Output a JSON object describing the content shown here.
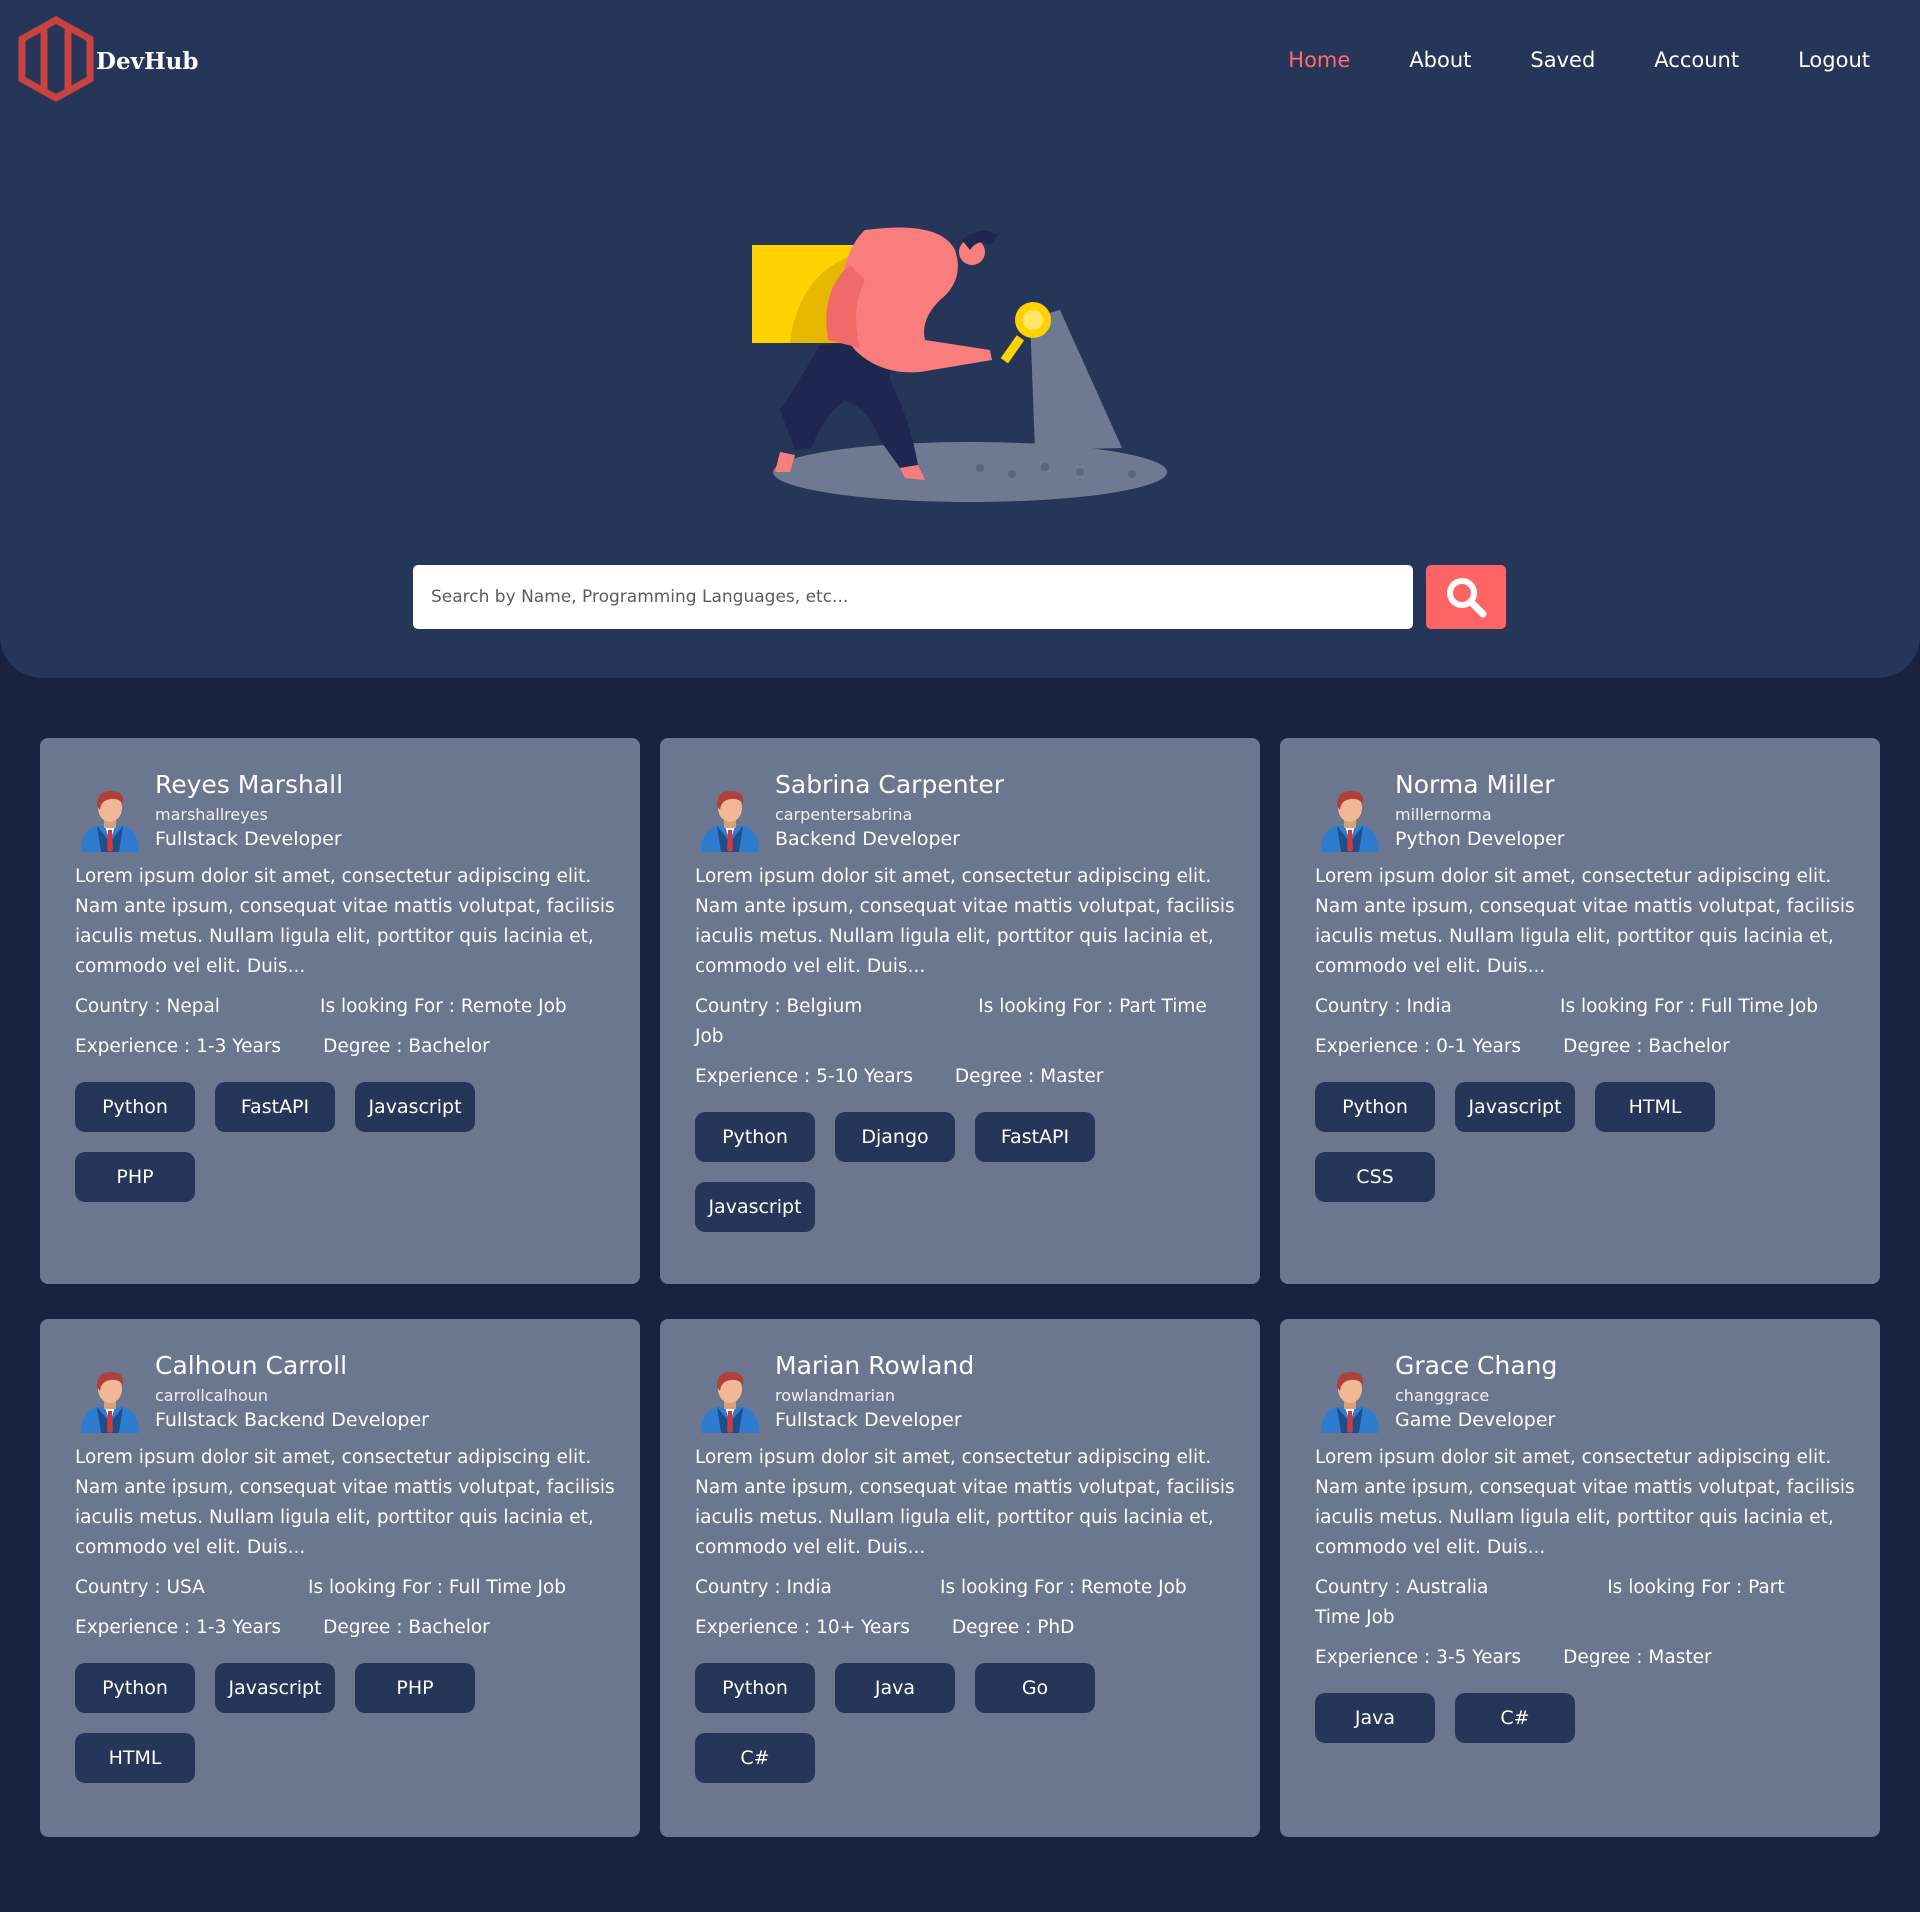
{
  "brand": {
    "name": "DevHub",
    "logo_icon": "hexagon-logo-icon",
    "accent": "#ff6b6b"
  },
  "nav": [
    {
      "label": "Home",
      "active": true
    },
    {
      "label": "About",
      "active": false
    },
    {
      "label": "Saved",
      "active": false
    },
    {
      "label": "Account",
      "active": false
    },
    {
      "label": "Logout",
      "active": false
    }
  ],
  "search": {
    "placeholder": "Search by Name, Programming Languages, etc...",
    "value": "",
    "button_icon": "search-icon"
  },
  "profiles": [
    {
      "name": "Reyes Marshall",
      "username": "marshallreyes",
      "role": "Fullstack Developer",
      "bio": "Lorem ipsum dolor sit amet, consectetur adipiscing elit. Nam ante ipsum, consequat vitae mattis volutpat, facilisis iaculis metus. Nullam ligula elit, porttitor quis lacinia et, commodo vel elit. Duis...",
      "country": "Country : Nepal",
      "looking_for": "Is looking For : Remote Job",
      "experience": "Experience : 1-3 Years",
      "degree": "Degree : Bachelor",
      "tags": [
        "Python",
        "FastAPI",
        "Javascript",
        "PHP"
      ]
    },
    {
      "name": "Sabrina Carpenter",
      "username": "carpentersabrina",
      "role": "Backend Developer",
      "bio": "Lorem ipsum dolor sit amet, consectetur adipiscing elit. Nam ante ipsum, consequat vitae mattis volutpat, facilisis iaculis metus. Nullam ligula elit, porttitor quis lacinia et, commodo vel elit. Duis...",
      "country": "Country : Belgium",
      "looking_for": "Is looking For : Part Time Job",
      "experience": "Experience : 5-10 Years",
      "degree": "Degree : Master",
      "tags": [
        "Python",
        "Django",
        "FastAPI",
        "Javascript"
      ]
    },
    {
      "name": "Norma Miller",
      "username": "millernorma",
      "role": "Python Developer",
      "bio": "Lorem ipsum dolor sit amet, consectetur adipiscing elit. Nam ante ipsum, consequat vitae mattis volutpat, facilisis iaculis metus. Nullam ligula elit, porttitor quis lacinia et, commodo vel elit. Duis...",
      "country": "Country : India",
      "looking_for": "Is looking For : Full Time Job",
      "experience": "Experience : 0-1 Years",
      "degree": "Degree : Bachelor",
      "tags": [
        "Python",
        "Javascript",
        "HTML",
        "CSS"
      ]
    },
    {
      "name": "Calhoun Carroll",
      "username": "carrollcalhoun",
      "role": "Fullstack Backend Developer",
      "bio": "Lorem ipsum dolor sit amet, consectetur adipiscing elit. Nam ante ipsum, consequat vitae mattis volutpat, facilisis iaculis metus. Nullam ligula elit, porttitor quis lacinia et, commodo vel elit. Duis...",
      "country": "Country : USA",
      "looking_for": "Is looking For : Full Time Job",
      "experience": "Experience : 1-3 Years",
      "degree": "Degree : Bachelor",
      "tags": [
        "Python",
        "Javascript",
        "PHP",
        "HTML"
      ]
    },
    {
      "name": "Marian Rowland",
      "username": "rowlandmarian",
      "role": "Fullstack Developer",
      "bio": "Lorem ipsum dolor sit amet, consectetur adipiscing elit. Nam ante ipsum, consequat vitae mattis volutpat, facilisis iaculis metus. Nullam ligula elit, porttitor quis lacinia et, commodo vel elit. Duis...",
      "country": "Country : India",
      "looking_for": "Is looking For : Remote Job",
      "experience": "Experience : 10+ Years",
      "degree": "Degree : PhD",
      "tags": [
        "Python",
        "Java",
        "Go",
        "C#"
      ]
    },
    {
      "name": "Grace Chang",
      "username": "changgrace",
      "role": "Game Developer",
      "bio": "Lorem ipsum dolor sit amet, consectetur adipiscing elit. Nam ante ipsum, consequat vitae mattis volutpat, facilisis iaculis metus. Nullam ligula elit, porttitor quis lacinia et, commodo vel elit. Duis...",
      "country": "Country : Australia",
      "looking_for": "Is looking For : Part Time Job",
      "experience": "Experience : 3-5 Years",
      "degree": "Degree : Master",
      "tags": [
        "Java",
        "C#"
      ]
    }
  ]
}
